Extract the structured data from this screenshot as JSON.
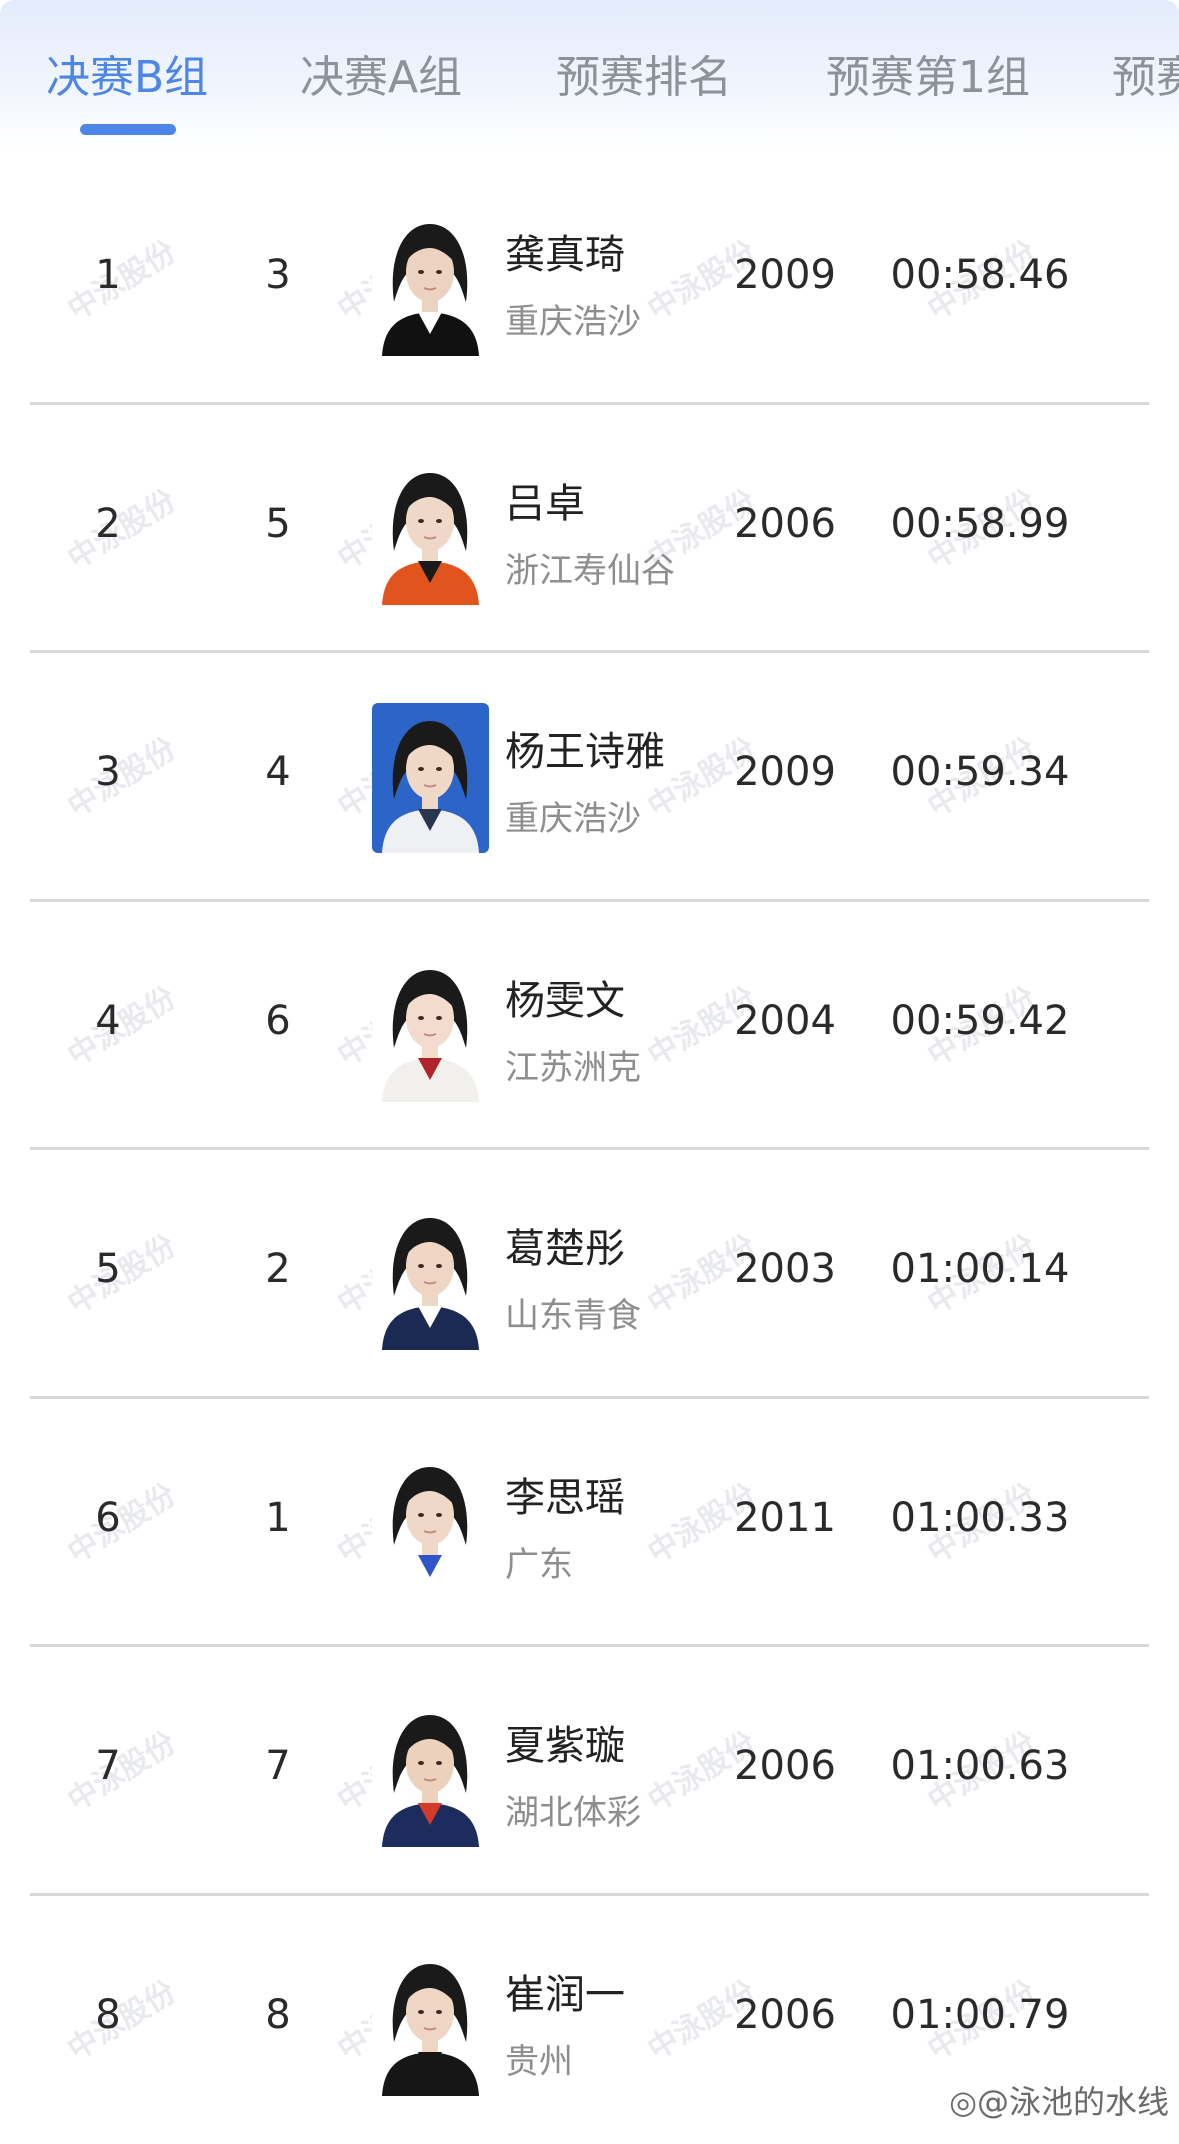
{
  "tabs": [
    {
      "label": "决赛B组",
      "active": true
    },
    {
      "label": "决赛A组",
      "active": false
    },
    {
      "label": "预赛排名",
      "active": false
    },
    {
      "label": "预赛第1组",
      "active": false
    },
    {
      "label": "预赛",
      "active": false
    }
  ],
  "results": [
    {
      "rank": "1",
      "lane": "3",
      "name": "龚真琦",
      "team": "重庆浩沙",
      "year": "2009",
      "time": "00:58.46",
      "photo": {
        "bg": "#ffffff",
        "hair": "#1a1a1a",
        "skin": "#ecd2c0",
        "clothes": "#111111",
        "accent": "#ffffff"
      }
    },
    {
      "rank": "2",
      "lane": "5",
      "name": "吕卓",
      "team": "浙江寿仙谷",
      "year": "2006",
      "time": "00:58.99",
      "photo": {
        "bg": "#ffffff",
        "hair": "#1a1a1a",
        "skin": "#efd8c8",
        "clothes": "#e2541e",
        "accent": "#1a1a1a"
      }
    },
    {
      "rank": "3",
      "lane": "4",
      "name": "杨王诗雅",
      "team": "重庆浩沙",
      "year": "2009",
      "time": "00:59.34",
      "photo": {
        "bg": "#2d64c8",
        "hair": "#1a1a1a",
        "skin": "#f0d8c6",
        "clothes": "#eef0f4",
        "accent": "#2a3550"
      }
    },
    {
      "rank": "4",
      "lane": "6",
      "name": "杨雯文",
      "team": "江苏洲克",
      "year": "2004",
      "time": "00:59.42",
      "photo": {
        "bg": "#ffffff",
        "hair": "#1a1a1a",
        "skin": "#f3dccd",
        "clothes": "#f1f0ec",
        "accent": "#b0232c"
      }
    },
    {
      "rank": "5",
      "lane": "2",
      "name": "葛楚彤",
      "team": "山东青食",
      "year": "2003",
      "time": "01:00.14",
      "photo": {
        "bg": "#ffffff",
        "hair": "#1a1a1a",
        "skin": "#efd6c4",
        "clothes": "#1b2a52",
        "accent": "#ffffff"
      }
    },
    {
      "rank": "6",
      "lane": "1",
      "name": "李思瑶",
      "team": "广东",
      "year": "2011",
      "time": "01:00.33",
      "photo": {
        "bg": "#ffffff",
        "hair": "#1a1a1a",
        "skin": "#efd8c8",
        "clothes": "#ffffff",
        "accent": "#2f55c9"
      }
    },
    {
      "rank": "7",
      "lane": "7",
      "name": "夏紫璇",
      "team": "湖北体彩",
      "year": "2006",
      "time": "01:00.63",
      "photo": {
        "bg": "#ffffff",
        "hair": "#1a1a1a",
        "skin": "#ecd1bc",
        "clothes": "#1c2c5c",
        "accent": "#d23a2a"
      }
    },
    {
      "rank": "8",
      "lane": "8",
      "name": "崔润一",
      "team": "贵州",
      "year": "2006",
      "time": "01:00.79",
      "photo": {
        "bg": "#ffffff",
        "hair": "#1a1a1a",
        "skin": "#efd6c4",
        "clothes": "#161616",
        "accent": "#161616"
      }
    }
  ],
  "watermark_text": "中泳股份",
  "footer_watermark": "@泳池的水线",
  "colors": {
    "accent": "#4d86e4",
    "tab_inactive": "#8d919a",
    "text": "#2a2a2a",
    "subtext": "#8e8e8e",
    "divider": "#d7d8dc"
  }
}
